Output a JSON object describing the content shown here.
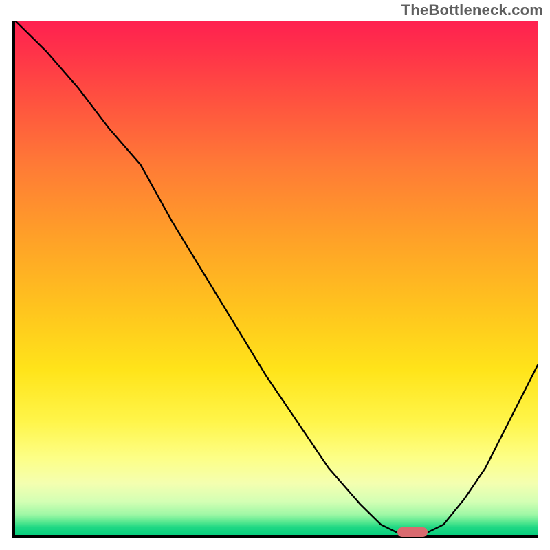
{
  "watermark": "TheBottleneck.com",
  "chart_data": {
    "type": "line",
    "title": "",
    "xlabel": "",
    "ylabel": "",
    "xlim": [
      0,
      100
    ],
    "ylim": [
      0,
      100
    ],
    "grid": false,
    "legend": false,
    "series": [
      {
        "name": "bottleneck-curve",
        "x": [
          0,
          6,
          12,
          18,
          24,
          30,
          36,
          42,
          48,
          54,
          60,
          66,
          70,
          74,
          78,
          82,
          86,
          90,
          94,
          98,
          100
        ],
        "y": [
          100,
          94,
          87,
          79,
          72,
          61,
          51,
          41,
          31,
          22,
          13,
          6,
          2,
          0,
          0,
          2,
          7,
          13,
          21,
          29,
          33
        ]
      }
    ],
    "marker": {
      "x": 76,
      "y": 0,
      "color": "#d96a6f"
    },
    "gradient_stops": [
      {
        "pos": 0,
        "color": "#ff2050"
      },
      {
        "pos": 0.5,
        "color": "#ffc41e"
      },
      {
        "pos": 0.85,
        "color": "#fdff86"
      },
      {
        "pos": 1.0,
        "color": "#08cf7e"
      }
    ]
  }
}
